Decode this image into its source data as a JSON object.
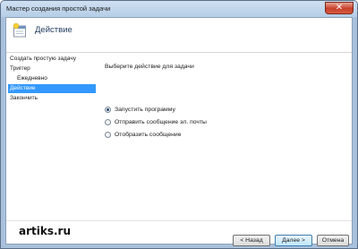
{
  "window": {
    "title": "Мастер создания простой задачи",
    "close_symbol": "✕"
  },
  "header": {
    "title": "Действие",
    "icon": "task-wizard-icon"
  },
  "sidebar": {
    "items": [
      {
        "label": "Создать простую задачу",
        "active": false
      },
      {
        "label": "Триггер",
        "active": false
      },
      {
        "label": "Ежедневно",
        "active": false
      },
      {
        "label": "Действие",
        "active": true
      },
      {
        "label": "Закончить",
        "active": false
      }
    ]
  },
  "content": {
    "prompt": "Выберите действие для задачи",
    "options": [
      {
        "label": "Запустить программу",
        "checked": true
      },
      {
        "label": "Отправить сообщение эл. почты",
        "checked": false
      },
      {
        "label": "Отобразить сообщение",
        "checked": false
      }
    ]
  },
  "footer": {
    "watermark": "artiks.ru",
    "back_label": "< Назад",
    "next_label": "Далее >",
    "cancel_label": "Отмена"
  },
  "colors": {
    "selection": "#3399ff",
    "window_frame": "#a9c1dc"
  }
}
